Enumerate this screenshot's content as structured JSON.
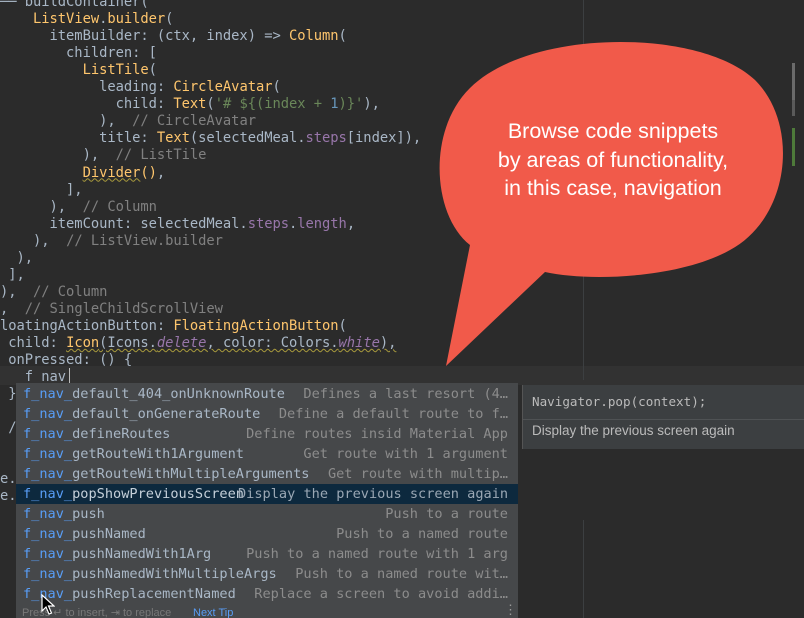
{
  "editor": {
    "lines": [
      [
        {
          "t": "── buildContainer(",
          "c": "plain"
        }
      ],
      [
        {
          "t": "    ",
          "c": "plain"
        },
        {
          "t": "ListView",
          "c": "call"
        },
        {
          "t": ".",
          "c": "plain"
        },
        {
          "t": "builder",
          "c": "call"
        },
        {
          "t": "(",
          "c": "plain"
        }
      ],
      [
        {
          "t": "      itemBuilder: (ctx, index) => ",
          "c": "plain"
        },
        {
          "t": "Column",
          "c": "call"
        },
        {
          "t": "(",
          "c": "plain"
        }
      ],
      [
        {
          "t": "        children: [",
          "c": "plain"
        }
      ],
      [
        {
          "t": "          ",
          "c": "plain"
        },
        {
          "t": "ListTile",
          "c": "call"
        },
        {
          "t": "(",
          "c": "plain"
        }
      ],
      [
        {
          "t": "            leading: ",
          "c": "plain"
        },
        {
          "t": "CircleAvatar",
          "c": "call"
        },
        {
          "t": "(",
          "c": "plain"
        }
      ],
      [
        {
          "t": "              child: ",
          "c": "plain"
        },
        {
          "t": "Text",
          "c": "call"
        },
        {
          "t": "(",
          "c": "plain"
        },
        {
          "t": "'# ${(index + ",
          "c": "string"
        },
        {
          "t": "1",
          "c": "num"
        },
        {
          "t": ")}'",
          "c": "string"
        },
        {
          "t": "),",
          "c": "plain"
        }
      ],
      [
        {
          "t": "            ),  ",
          "c": "plain"
        },
        {
          "t": "// CircleAvatar",
          "c": "comment"
        }
      ],
      [
        {
          "t": "            title: ",
          "c": "plain"
        },
        {
          "t": "Text",
          "c": "call"
        },
        {
          "t": "(selectedMeal.",
          "c": "plain"
        },
        {
          "t": "steps",
          "c": "field"
        },
        {
          "t": "[index]),",
          "c": "plain"
        }
      ],
      [
        {
          "t": "          ),  ",
          "c": "plain"
        },
        {
          "t": "// ListTile",
          "c": "comment"
        }
      ],
      [
        {
          "t": "          ",
          "c": "plain"
        },
        {
          "t": "Divider",
          "c": "warn"
        },
        {
          "t": "()",
          "c": "call"
        },
        {
          "t": ",",
          "c": "plain"
        }
      ],
      [
        {
          "t": "        ],",
          "c": "plain"
        }
      ],
      [
        {
          "t": "      ),  ",
          "c": "plain"
        },
        {
          "t": "// Column",
          "c": "comment"
        }
      ],
      [
        {
          "t": "      itemCount: selectedMeal.",
          "c": "plain"
        },
        {
          "t": "steps",
          "c": "field"
        },
        {
          "t": ".",
          "c": "plain"
        },
        {
          "t": "length",
          "c": "field"
        },
        {
          "t": ",",
          "c": "plain"
        }
      ],
      [
        {
          "t": "    ),  ",
          "c": "plain"
        },
        {
          "t": "// ListView.builder",
          "c": "comment"
        }
      ],
      [
        {
          "t": "  ),",
          "c": "plain"
        }
      ],
      [
        {
          "t": " ],",
          "c": "plain"
        }
      ],
      [
        {
          "t": "),  ",
          "c": "plain"
        },
        {
          "t": "// Column",
          "c": "comment"
        }
      ],
      [
        {
          "t": ",  ",
          "c": "plain"
        },
        {
          "t": "// SingleChildScrollView",
          "c": "comment"
        }
      ],
      [
        {
          "t": "loatingActionButton: ",
          "c": "plain"
        },
        {
          "t": "FloatingActionButton",
          "c": "call"
        },
        {
          "t": "(",
          "c": "plain"
        }
      ],
      [
        {
          "t": " child: ",
          "c": "plain"
        },
        {
          "t": "Icon",
          "c": "warn"
        },
        {
          "t": "(Icons.",
          "c": "warnplain"
        },
        {
          "t": "delete",
          "c": "warnfield"
        },
        {
          "t": ", color: Colors.",
          "c": "warnplain"
        },
        {
          "t": "white",
          "c": "warnfield"
        },
        {
          "t": "),",
          "c": "warnplain"
        }
      ],
      [
        {
          "t": " onPressed: () {",
          "c": "plain"
        }
      ],
      [
        {
          "t": "   f_nav_",
          "c": "plain"
        }
      ],
      [
        {
          "t": " }",
          "c": "plain"
        }
      ],
      [
        {
          "t": "",
          "c": "plain"
        }
      ],
      [
        {
          "t": " /",
          "c": "plain"
        }
      ],
      [
        {
          "t": "",
          "c": "plain"
        }
      ],
      [
        {
          "t": "",
          "c": "plain"
        }
      ],
      [
        {
          "t": "e.c",
          "c": "plain"
        }
      ],
      [
        {
          "t": "e.c",
          "c": "plain"
        }
      ]
    ]
  },
  "callout": {
    "lines": [
      "Browse code snippets",
      "by areas of functionality,",
      "in this case, navigation"
    ],
    "color": "#f15a4a"
  },
  "completion": {
    "typed_prefix": "f_nav_",
    "items": [
      {
        "name": "default_404_onUnknownRoute",
        "desc": "Defines a last resort (4…"
      },
      {
        "name": "default_onGenerateRoute",
        "desc": "Define a default route to f…"
      },
      {
        "name": "defineRoutes",
        "desc": "Define routes insid Material App"
      },
      {
        "name": "getRouteWith1Argument",
        "desc": "Get route with 1 argument"
      },
      {
        "name": "getRouteWithMultipleArguments",
        "desc": "Get route with multip…"
      },
      {
        "name": "popShowPreviousScreen",
        "desc": "Display the previous screen again",
        "selected": true
      },
      {
        "name": "push",
        "desc": "Push to a route"
      },
      {
        "name": "pushNamed",
        "desc": "Push to a named route"
      },
      {
        "name": "pushNamedWith1Arg",
        "desc": "Push to a named route with 1 arg"
      },
      {
        "name": "pushNamedWithMultipleArgs",
        "desc": "Push to a named route wit…"
      },
      {
        "name": "pushReplacementNamed",
        "desc": "Replace a screen to avoid addi…"
      }
    ],
    "footer_hint": "Press ↵ to insert, ⇥ to replace",
    "footer_link": "Next Tip",
    "more_icon": "vertical-ellipsis-icon"
  },
  "documentation": {
    "code": "Navigator.pop(context);",
    "text": "Display the previous screen again"
  },
  "colors": {
    "editor_bg": "#2b2b2b",
    "popup_bg": "#46484a",
    "selection": "#0d293e",
    "match_highlight": "#589df6"
  }
}
